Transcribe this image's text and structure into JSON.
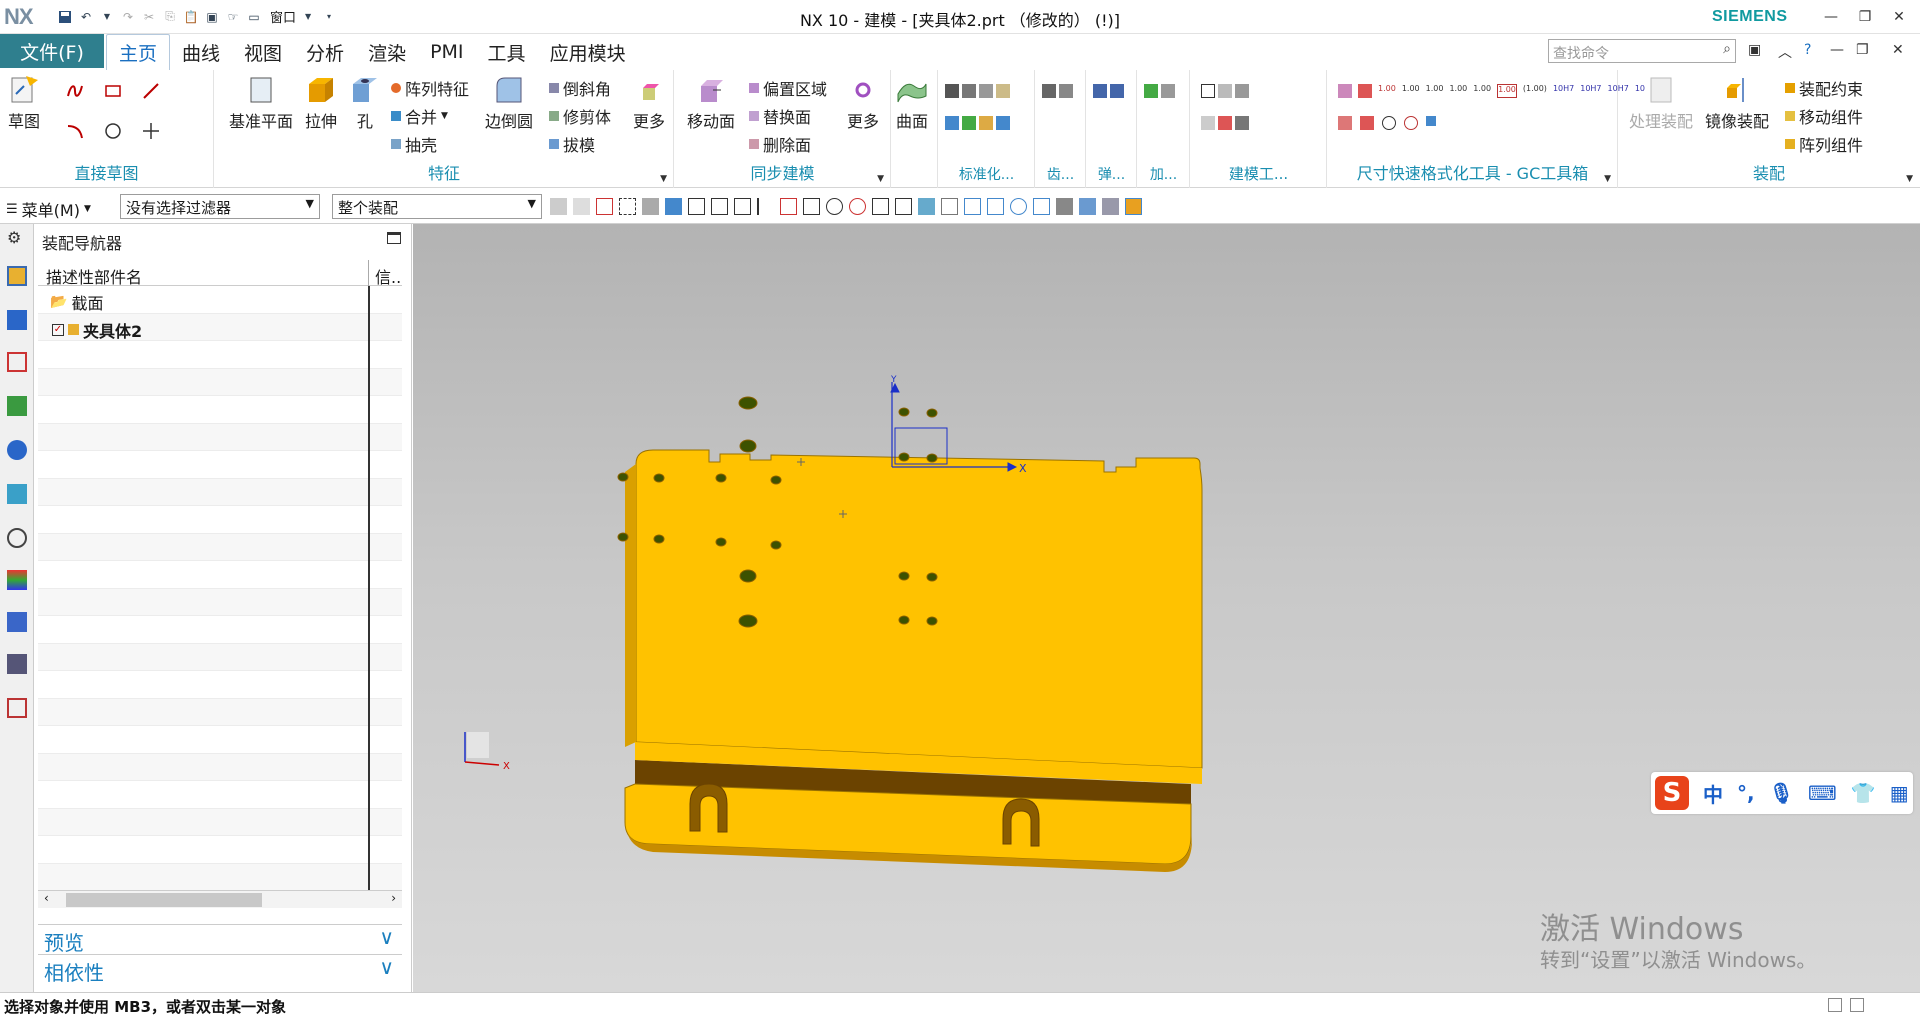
{
  "app": {
    "logo": "NX",
    "window_menu": "窗口",
    "title": "NX 10 - 建模 - [夹具体2.prt （修改的） (!)]",
    "brand": "SIEMENS"
  },
  "menu": {
    "file": "文件(F)",
    "tabs": [
      "主页",
      "曲线",
      "视图",
      "分析",
      "渲染",
      "PMI",
      "工具",
      "应用模块"
    ],
    "search_placeholder": "查找命令"
  },
  "ribbon": {
    "groups": {
      "sketch": {
        "name": "直接草图",
        "sketch_btn": "草图"
      },
      "feature": {
        "name": "特征",
        "datum": "基准平面",
        "extrude": "拉伸",
        "hole": "孔",
        "pattern": "阵列特征",
        "unite": "合并",
        "shell": "抽壳",
        "edge_blend": "边倒圆",
        "chamfer": "倒斜角",
        "trim": "修剪体",
        "draft": "拔模",
        "more": "更多"
      },
      "sync": {
        "name": "同步建模",
        "move_face": "移动面",
        "offset": "偏置区域",
        "replace": "替换面",
        "delete": "删除面",
        "more": "更多"
      },
      "surface": {
        "btn": "曲面"
      },
      "standard": {
        "name": "标准化..."
      },
      "gear": {
        "name": "齿..."
      },
      "spring": {
        "name": "弹..."
      },
      "add": {
        "name": "加..."
      },
      "modeling": {
        "name": "建模工..."
      },
      "gc": {
        "name": "尺寸快速格式化工具 - GC工具箱",
        "tolerance_labels": [
          "1.00",
          "10H7",
          "(1.00)"
        ]
      },
      "assembly": {
        "name": "装配",
        "process": "处理装配",
        "mirror": "镜像装配",
        "constraint": "装配约束",
        "move": "移动组件",
        "pattern": "阵列组件"
      }
    }
  },
  "toolbar2": {
    "menu": "菜单(M)",
    "filter": "没有选择过滤器",
    "scope": "整个装配"
  },
  "navigator": {
    "title": "装配导航器",
    "col_name": "描述性部件名",
    "col_info": "信..",
    "items": [
      {
        "label": "截面"
      },
      {
        "label": "夹具体2"
      }
    ],
    "preview": "预览",
    "dependency": "相依性"
  },
  "viewport": {
    "axis_x": "X",
    "axis_y": "Y",
    "part_color": "#ffc200"
  },
  "watermark": {
    "line1": "激活 Windows",
    "line2": "转到“设置”以激活 Windows。"
  },
  "ime": {
    "lang": "中",
    "punct": "°,"
  },
  "status": {
    "text": "选择对象并使用 MB3，或者双击某一对象"
  }
}
